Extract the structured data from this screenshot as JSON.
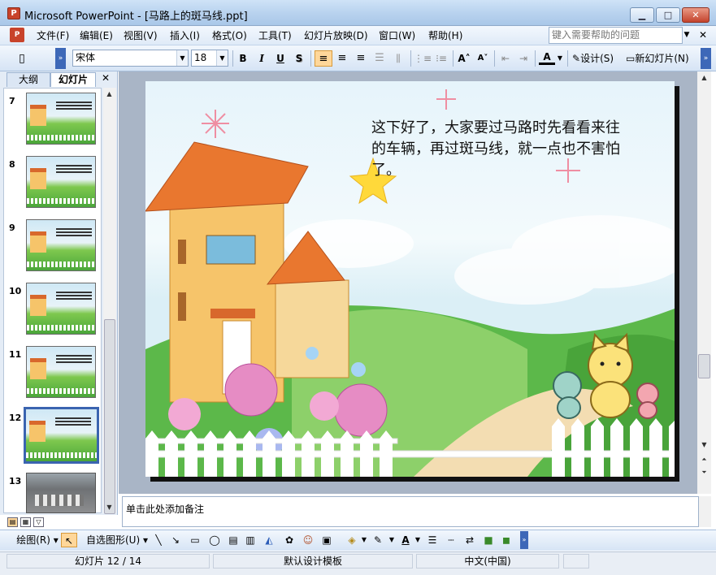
{
  "window": {
    "title": "Microsoft PowerPoint - [马路上的斑马线.ppt]",
    "app_icon": "powerpoint-icon"
  },
  "window_buttons": {
    "minimize": "▁",
    "maximize": "□",
    "close": "✕"
  },
  "menu": [
    "文件(F)",
    "编辑(E)",
    "视图(V)",
    "插入(I)",
    "格式(O)",
    "工具(T)",
    "幻灯片放映(D)",
    "窗口(W)",
    "帮助(H)"
  ],
  "help_placeholder": "键入需要帮助的问题",
  "toolbar": {
    "font": "宋体",
    "size": "18",
    "bold": "B",
    "italic": "I",
    "underline": "U",
    "shadow": "S",
    "font_color": "A",
    "design": "设计(S)",
    "new_slide": "新幻灯片(N)"
  },
  "pane_tabs": {
    "outline": "大纲",
    "slides": "幻灯片",
    "close": "✕"
  },
  "slides": [
    {
      "num": "7"
    },
    {
      "num": "8"
    },
    {
      "num": "9"
    },
    {
      "num": "10"
    },
    {
      "num": "11"
    },
    {
      "num": "12"
    },
    {
      "num": "13"
    }
  ],
  "slide_text": "这下好了，大家要过马路时先看看来往的车辆，再过斑马线，就一点也不害怕了。",
  "notes": "单击此处添加备注",
  "drawbar": {
    "draw": "绘图(R)",
    "autoshapes": "自选图形(U)"
  },
  "status": {
    "slide": "幻灯片 12 / 14",
    "template": "默认设计模板",
    "language": "中文(中国)"
  },
  "colors": {
    "accent": "#3a64b0",
    "title_bar": "#b9d3ef",
    "slide_bg": "#e6f4fb"
  }
}
